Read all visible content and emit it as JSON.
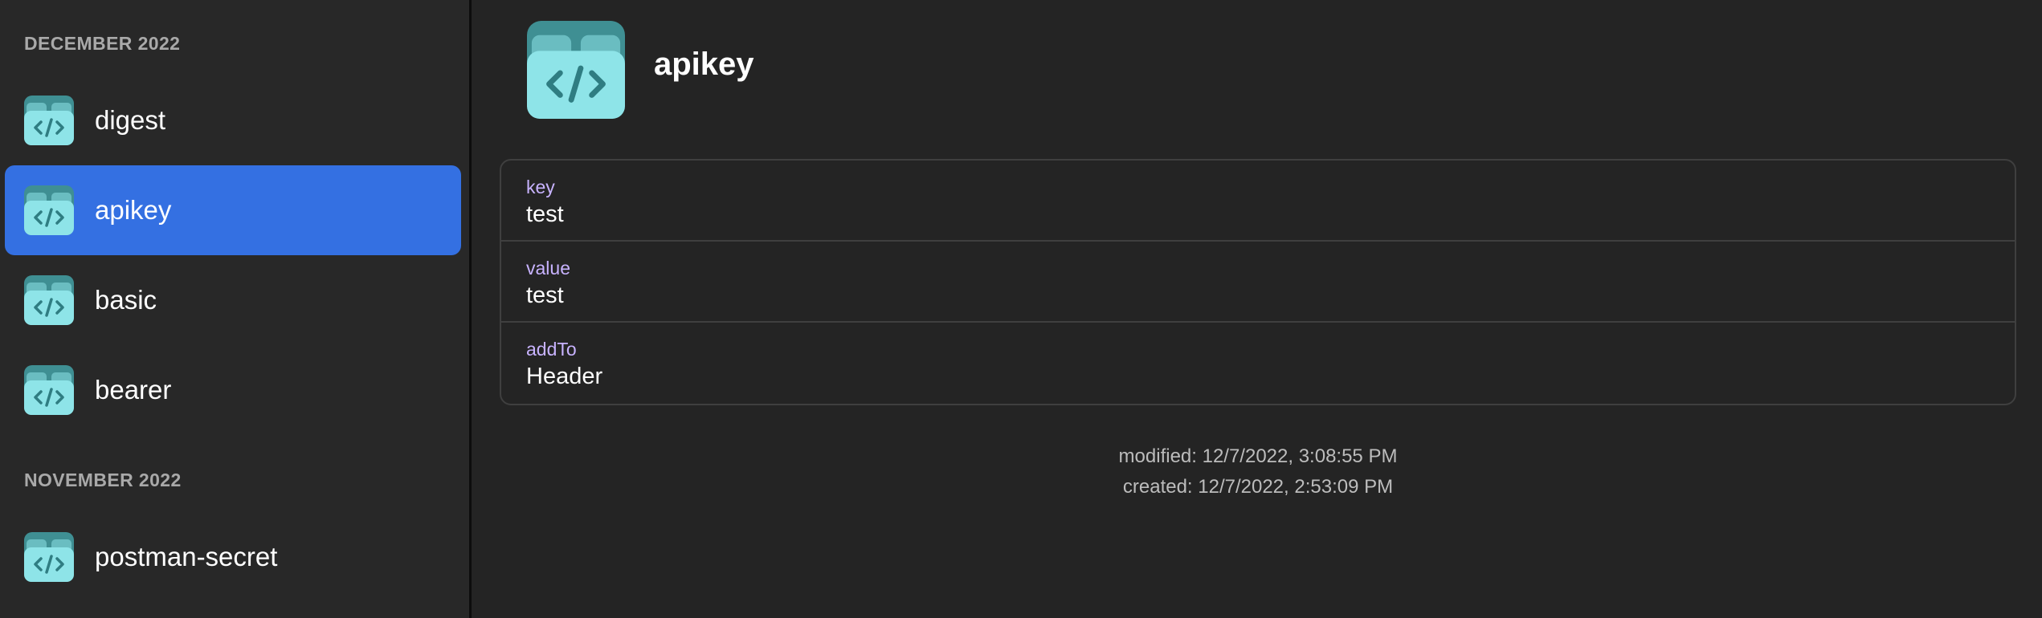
{
  "sidebar": {
    "groups": [
      {
        "header": "DECEMBER 2022",
        "items": [
          {
            "label": "digest",
            "icon": "code-file-icon",
            "selected": false
          },
          {
            "label": "apikey",
            "icon": "code-file-icon",
            "selected": true
          },
          {
            "label": "basic",
            "icon": "code-file-icon",
            "selected": false
          },
          {
            "label": "bearer",
            "icon": "code-file-icon",
            "selected": false
          }
        ]
      },
      {
        "header": "NOVEMBER 2022",
        "items": [
          {
            "label": "postman-secret",
            "icon": "code-file-icon",
            "selected": false
          }
        ]
      }
    ]
  },
  "detail": {
    "title": "apikey",
    "icon": "code-file-icon",
    "fields": [
      {
        "key": "key",
        "value": "test"
      },
      {
        "key": "value",
        "value": "test"
      },
      {
        "key": "addTo",
        "value": "Header"
      }
    ],
    "modified": "modified: 12/7/2022, 3:08:55 PM",
    "created": "created: 12/7/2022, 2:53:09 PM"
  },
  "colors": {
    "background": "#242424",
    "sidebar": "#282828",
    "selection": "#3470e2",
    "field_key": "#c8b3ff",
    "icon_dark": "#3f8f93",
    "icon_light": "#8ee4e8"
  }
}
